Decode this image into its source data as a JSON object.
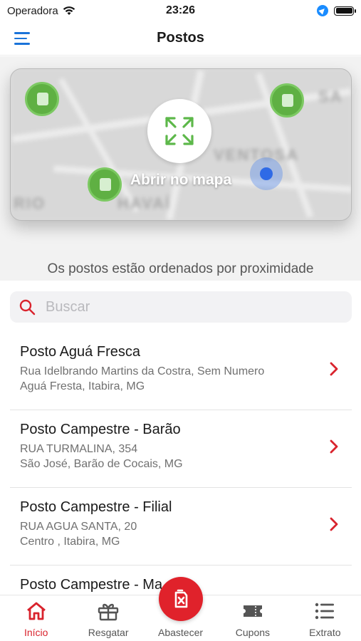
{
  "status_bar": {
    "carrier": "Operadora",
    "time": "23:26"
  },
  "nav": {
    "title": "Postos",
    "menu_icon": "hamburger-menu-icon"
  },
  "map": {
    "open_label": "Abrir no mapa",
    "expand_icon": "expand-arrows-icon",
    "map_labels": [
      "VENTOSA",
      "HAVAÍ",
      "RIO",
      "SA"
    ]
  },
  "hint": "Os postos estão ordenados por proximidade",
  "search": {
    "placeholder": "Buscar",
    "icon": "search-icon"
  },
  "stations": [
    {
      "name": "Posto Aguá Fresca",
      "address1": "Rua Idelbrando Martins da Costra, Sem Numero",
      "address2": "Aguá Fresta, Itabira, MG"
    },
    {
      "name": "Posto Campestre - Barão",
      "address1": "RUA TURMALINA, 354",
      "address2": "São José, Barão de Cocais, MG"
    },
    {
      "name": "Posto Campestre - Filial",
      "address1": "RUA AGUA SANTA, 20",
      "address2": "Centro , Itabira, MG"
    },
    {
      "name": "Posto Campestre - Ma",
      "address1": "",
      "address2": ""
    }
  ],
  "tabs": [
    {
      "label": "Início",
      "icon": "home-icon",
      "active": true
    },
    {
      "label": "Resgatar",
      "icon": "gift-icon",
      "active": false
    },
    {
      "label": "Abastecer",
      "icon": "fuel-pump-icon",
      "active": false
    },
    {
      "label": "Cupons",
      "icon": "ticket-icon",
      "active": false
    },
    {
      "label": "Extrato",
      "icon": "list-icon",
      "active": false
    }
  ],
  "colors": {
    "accent_red": "#e0222b",
    "menu_blue": "#1a73d9",
    "pin_green": "#5fb043",
    "user_blue": "#2f6ae6"
  }
}
